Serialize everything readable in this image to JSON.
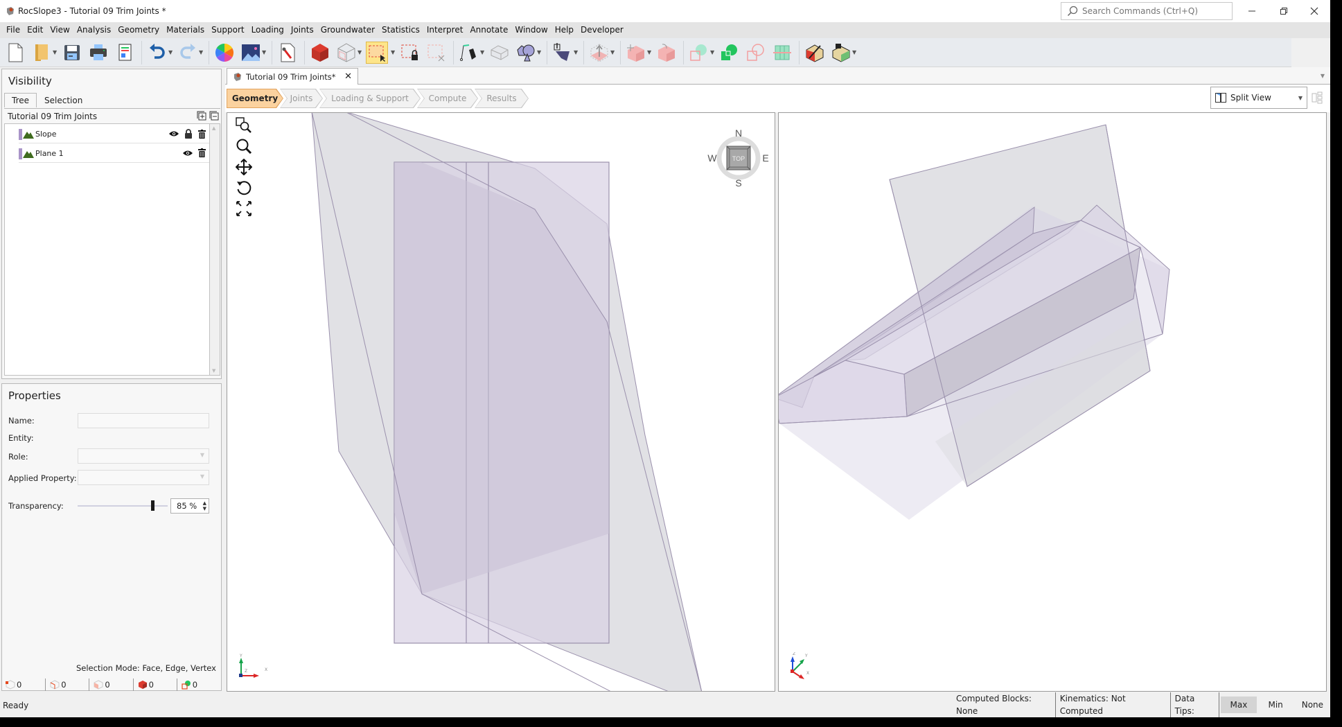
{
  "window": {
    "title": "RocSlope3 - Tutorial 09 Trim Joints *",
    "search_placeholder": "Search Commands (Ctrl+Q)",
    "controls": [
      "minimize",
      "restore",
      "close"
    ]
  },
  "menu": [
    "File",
    "Edit",
    "View",
    "Analysis",
    "Geometry",
    "Materials",
    "Support",
    "Loading",
    "Joints",
    "Groundwater",
    "Statistics",
    "Interpret",
    "Annotate",
    "Window",
    "Help",
    "Developer"
  ],
  "toolbar": {
    "buttons": [
      {
        "name": "new-file",
        "dropdown": false
      },
      {
        "name": "open-folder",
        "dropdown": true
      },
      {
        "name": "save",
        "dropdown": false
      },
      {
        "name": "print",
        "dropdown": false
      },
      {
        "name": "report",
        "dropdown": false
      },
      {
        "name": "undo",
        "dropdown": true
      },
      {
        "name": "redo",
        "dropdown": true
      },
      {
        "name": "color-wheel",
        "dropdown": false
      },
      {
        "name": "background-image",
        "dropdown": true
      },
      {
        "name": "project-settings",
        "dropdown": false
      },
      {
        "name": "solid-view",
        "dropdown": false
      },
      {
        "name": "wireframe-view",
        "dropdown": true
      },
      {
        "name": "select-window",
        "dropdown": true,
        "active": true
      },
      {
        "name": "lock-selection",
        "dropdown": false
      },
      {
        "name": "clear-selection",
        "dropdown": false
      },
      {
        "name": "draw-polyline",
        "dropdown": true
      },
      {
        "name": "extrude-surface",
        "dropdown": false
      },
      {
        "name": "boolean-shapes",
        "dropdown": true
      },
      {
        "name": "import-surface",
        "dropdown": true
      },
      {
        "name": "move-up",
        "dropdown": true
      },
      {
        "name": "translate-block",
        "dropdown": true
      },
      {
        "name": "rotate-block",
        "dropdown": false
      },
      {
        "name": "union",
        "dropdown": true
      },
      {
        "name": "intersect",
        "dropdown": false
      },
      {
        "name": "subtract",
        "dropdown": false
      },
      {
        "name": "grid-section",
        "dropdown": false
      },
      {
        "name": "edit-slope",
        "dropdown": false
      },
      {
        "name": "excavate",
        "dropdown": true
      }
    ]
  },
  "visibility": {
    "title": "Visibility",
    "tabs": [
      "Tree",
      "Selection"
    ],
    "active_tab": "Tree",
    "root": "Tutorial 09 Trim Joints",
    "items": [
      {
        "label": "Slope",
        "color": "#a994c8",
        "visible": true,
        "locked": true,
        "deletable": true
      },
      {
        "label": "Plane 1",
        "color": "#a994c8",
        "visible": true,
        "locked": false,
        "deletable": true
      }
    ]
  },
  "properties": {
    "title": "Properties",
    "name_label": "Name:",
    "name_value": "",
    "entity_label": "Entity:",
    "role_label": "Role:",
    "role_value": "",
    "applied_label": "Applied Property:",
    "applied_value": "",
    "transparency_label": "Transparency:",
    "transparency_value": "85 %",
    "transparency_percent": 85,
    "selection_mode": "Selection Mode: Face, Edge, Vertex",
    "counts": [
      {
        "icon": "vertex-count-icon",
        "value": "0"
      },
      {
        "icon": "edge-count-icon",
        "value": "0"
      },
      {
        "icon": "face-count-icon",
        "value": "0"
      },
      {
        "icon": "block-count-icon",
        "value": "0"
      },
      {
        "icon": "group-count-icon",
        "value": "0"
      }
    ]
  },
  "document": {
    "tab_label": "Tutorial 09 Trim Joints*",
    "workflow": [
      "Geometry",
      "Joints",
      "Loading & Support",
      "Compute",
      "Results"
    ],
    "active_step": "Geometry",
    "view_mode": "Split View"
  },
  "viewports": {
    "left": {
      "view": "TOP",
      "compass": {
        "n": "N",
        "s": "S",
        "e": "E",
        "w": "W",
        "center": "TOP"
      },
      "axes": {
        "x": "X",
        "y": "Y",
        "z": "Z"
      }
    },
    "right": {
      "view": "Perspective",
      "axes": {
        "x": "X",
        "y": "Y",
        "z": "Z"
      }
    }
  },
  "colors": {
    "slope_fill": "#c8c1d6",
    "plane_fill": "#d8d8dc",
    "edge": "#9a90ac",
    "active_step": "#fbd29f",
    "active_tool": "#fde58a"
  },
  "status": {
    "left": "Ready",
    "computed_blocks_label": "Computed Blocks:",
    "computed_blocks_value": "None",
    "kinematics_label": "Kinematics:",
    "kinematics_value": "Not Computed",
    "data_tips_label": "Data Tips:",
    "data_tips_options": [
      "Max",
      "Min",
      "None"
    ],
    "data_tips_selected": "Max"
  }
}
